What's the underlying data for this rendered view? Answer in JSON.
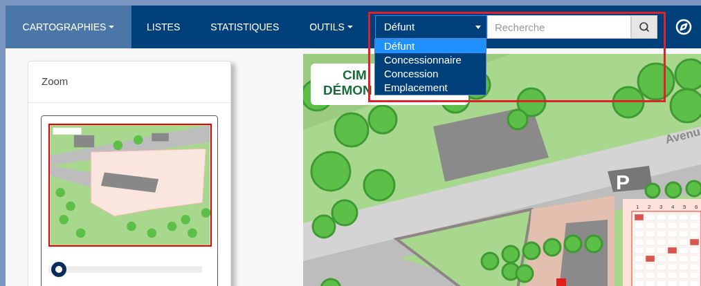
{
  "navbar": {
    "items": [
      {
        "label": "CARTOGRAPHIES",
        "selected": true,
        "has_caret": true
      },
      {
        "label": "LISTES",
        "selected": false,
        "has_caret": false
      },
      {
        "label": "STATISTIQUES",
        "selected": false,
        "has_caret": false
      },
      {
        "label": "OUTILS",
        "selected": false,
        "has_caret": true
      }
    ],
    "search_type": {
      "value": "Défunt",
      "expanded": true,
      "options": [
        {
          "label": "Défunt",
          "selected": true
        },
        {
          "label": "Concessionnaire",
          "selected": false
        },
        {
          "label": "Concession",
          "selected": false
        },
        {
          "label": "Emplacement",
          "selected": false
        }
      ]
    },
    "search": {
      "placeholder": "Recherche"
    },
    "highlighted": true
  },
  "zoom_panel": {
    "title": "Zoom",
    "slider": {
      "level": 0.02
    }
  },
  "map": {
    "title_lines": [
      "CIM",
      "DÉMON"
    ],
    "road_label": "Avenu",
    "parking_sign": "P",
    "column_numbers": [
      "1",
      "2",
      "3",
      "4",
      "5",
      "6"
    ]
  }
}
